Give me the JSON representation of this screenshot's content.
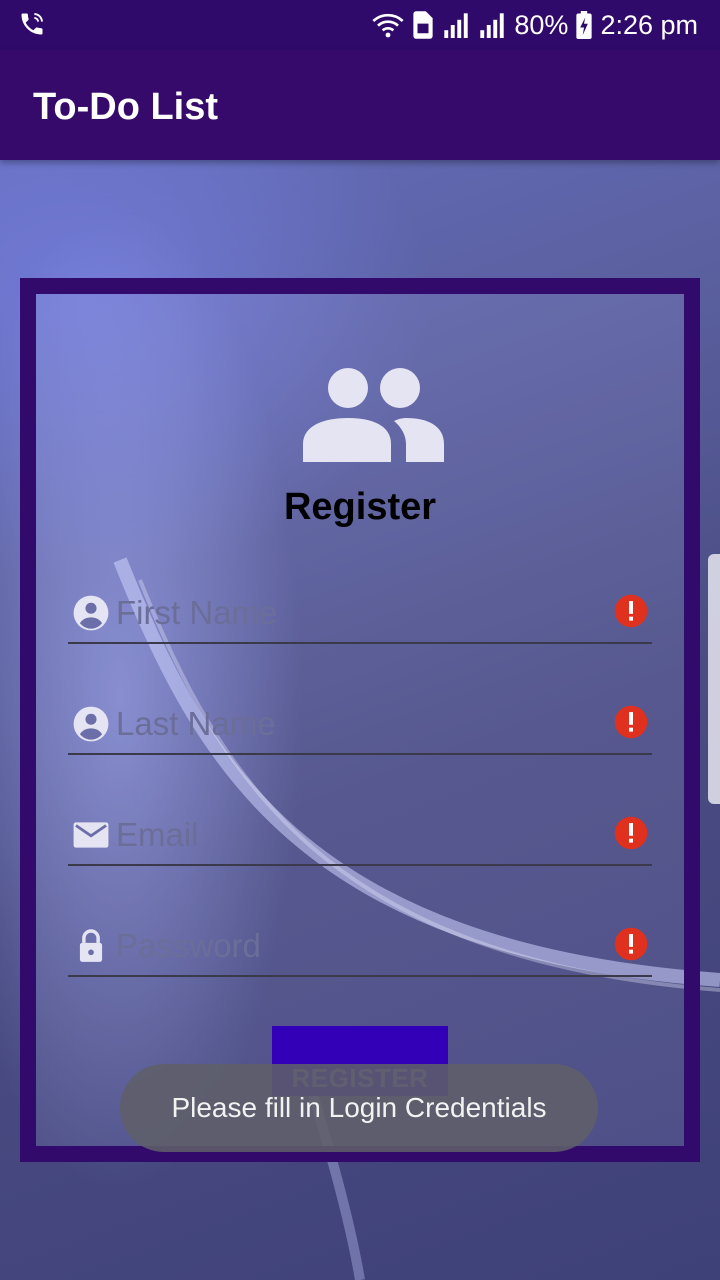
{
  "status_bar": {
    "battery_text": "80%",
    "time": "2:26 pm",
    "icons": [
      "phone-call-icon",
      "wifi-icon",
      "sim-icon",
      "signal-icon",
      "signal-icon",
      "battery-charging-icon"
    ]
  },
  "app_bar": {
    "title": "To-Do List"
  },
  "form": {
    "heading": "Register",
    "heading_icon": "users-icon",
    "fields": [
      {
        "placeholder": "First Name",
        "icon": "account-circle-icon",
        "error_icon": "error-icon"
      },
      {
        "placeholder": "Last Name",
        "icon": "account-circle-icon",
        "error_icon": "error-icon"
      },
      {
        "placeholder": "Email",
        "icon": "mail-icon",
        "error_icon": "error-icon"
      },
      {
        "placeholder": "Password",
        "icon": "lock-icon",
        "error_icon": "error-icon"
      }
    ],
    "register_label": "REGISTER"
  },
  "toast": {
    "message": "Please fill in Login Credentials"
  },
  "colors": {
    "app_bar": "#350a6a",
    "card_border": "#310a6c",
    "button": "#3300b8",
    "error": "#e0301e"
  }
}
